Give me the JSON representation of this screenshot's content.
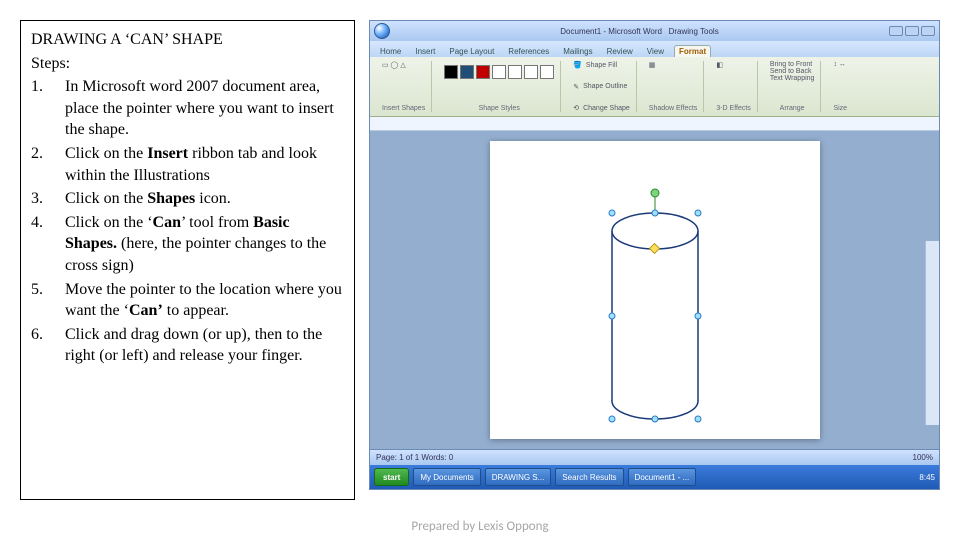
{
  "left": {
    "title": "DRAWING A ‘CAN’ SHAPE",
    "steps_label": "Steps:",
    "items": [
      {
        "num": "1.",
        "text": "In Microsoft word 2007 document area, place the pointer where you want to insert the shape."
      },
      {
        "num": "2.",
        "html": "Click on the <b>Insert</b> ribbon tab and look within the Illustrations"
      },
      {
        "num": "3.",
        "html": "Click on the <b>Shapes</b> icon."
      },
      {
        "num": "4.",
        "html": "Click on the ‘<b>Can</b>’ tool from <b>Basic Shapes.</b> (here, the pointer changes to the cross sign)"
      },
      {
        "num": "5.",
        "html": "Move the pointer to the location where you want the ‘<b>Can’</b> to appear."
      },
      {
        "num": "6.",
        "text": "Click and drag down (or up), then to the right (or left)  and release your finger."
      }
    ]
  },
  "word": {
    "window_title": "Document1 - Microsoft Word",
    "context_tab": "Drawing Tools",
    "tabs": [
      "Home",
      "Insert",
      "Page Layout",
      "References",
      "Mailings",
      "Review",
      "View"
    ],
    "active_tab": "Format",
    "ribbon": {
      "group1": "Insert Shapes",
      "group2": "Shape Styles",
      "group3": "Shadow Effects",
      "group4": "3-D Effects",
      "group5": "Arrange",
      "group6": "Size",
      "shapefill": "Shape Fill",
      "shapeoutline": "Shape Outline",
      "changeshape": "Change Shape",
      "bringfront": "Bring to Front",
      "sendback": "Send to Back",
      "textwrap": "Text Wrapping"
    },
    "status_left": "Page: 1 of 1   Words: 0",
    "status_right": "100%"
  },
  "taskbar": {
    "start": "start",
    "items": [
      "My Documents",
      "DRAWING S...",
      "Search Results",
      "Document1 - ..."
    ],
    "clock": "8:45"
  },
  "footer": "Prepared by Lexis Oppong"
}
